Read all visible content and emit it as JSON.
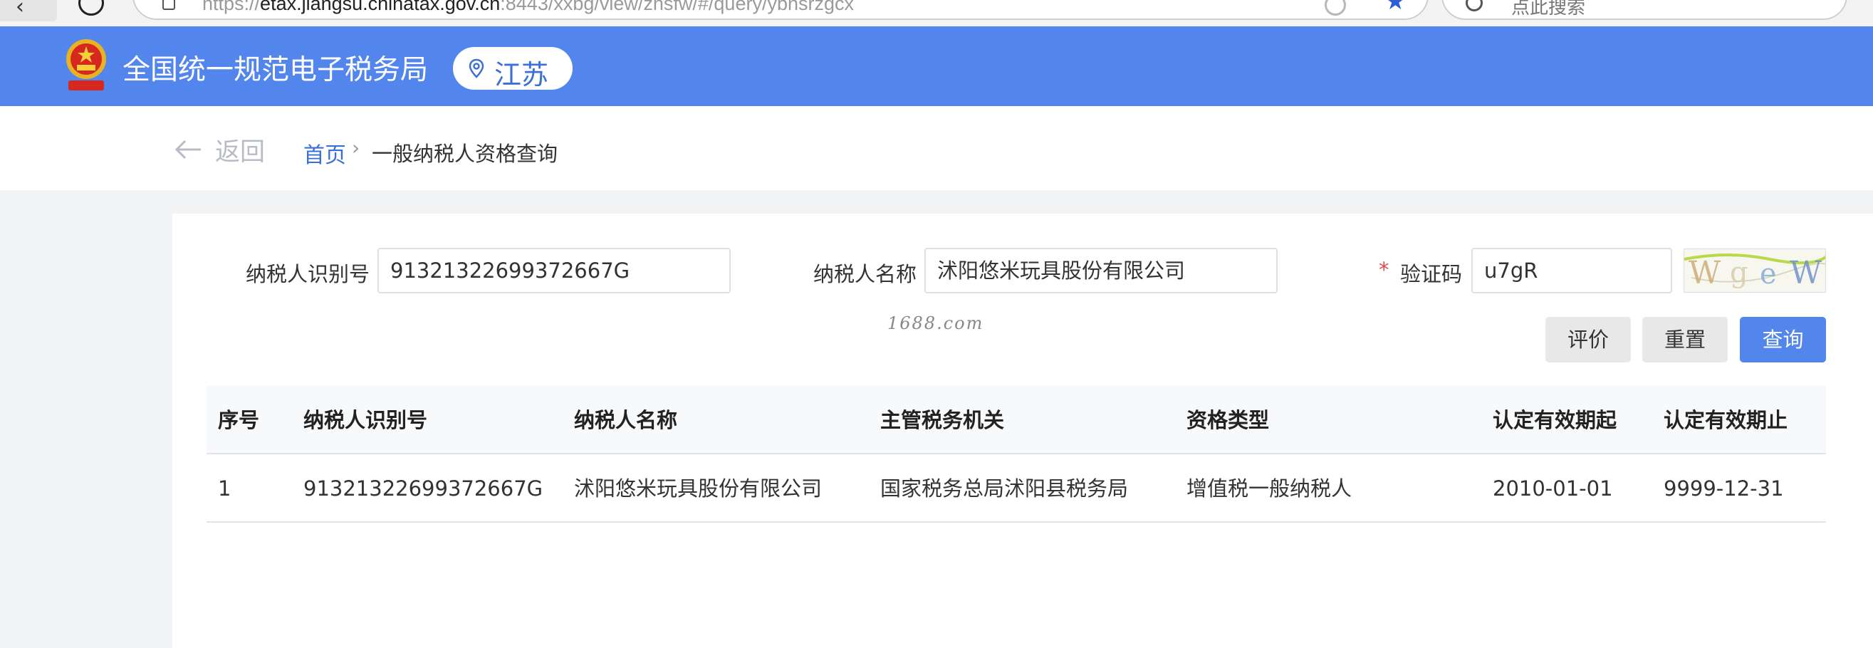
{
  "browser": {
    "url_prefix": "https://",
    "url_domain": "etax.jiangsu.chinatax.gov.cn",
    "url_rest": ":8443/xxbg/view/zhsfw/#/query/ybnsrzgcx",
    "search_placeholder": "点此搜索"
  },
  "header": {
    "site_title": "全国统一规范电子税务局",
    "region": "江苏",
    "brand_color": "#5286ec"
  },
  "breadcrumb": {
    "back_label": "返回",
    "home_label": "首页",
    "separator": "›",
    "current_label": "一般纳税人资格查询"
  },
  "form": {
    "taxpayer_id_label": "纳税人识别号",
    "taxpayer_id_value": "91321322699372667G",
    "taxpayer_name_label": "纳税人名称",
    "taxpayer_name_value": "沭阳悠米玩具股份有限公司",
    "required_mark": "*",
    "captcha_label": "验证码",
    "captcha_value": "u7gR",
    "captcha_image_text": "WgeW"
  },
  "watermark": "1688.com",
  "buttons": {
    "evaluate": "评价",
    "reset": "重置",
    "query": "查询"
  },
  "table": {
    "columns": [
      "序号",
      "纳税人识别号",
      "纳税人名称",
      "主管税务机关",
      "资格类型",
      "认定有效期起",
      "认定有效期止"
    ],
    "rows": [
      [
        "1",
        "91321322699372667G",
        "沭阳悠米玩具股份有限公司",
        "国家税务总局沭阳县税务局",
        "增值税一般纳税人",
        "2010-01-01",
        "9999-12-31"
      ]
    ]
  }
}
